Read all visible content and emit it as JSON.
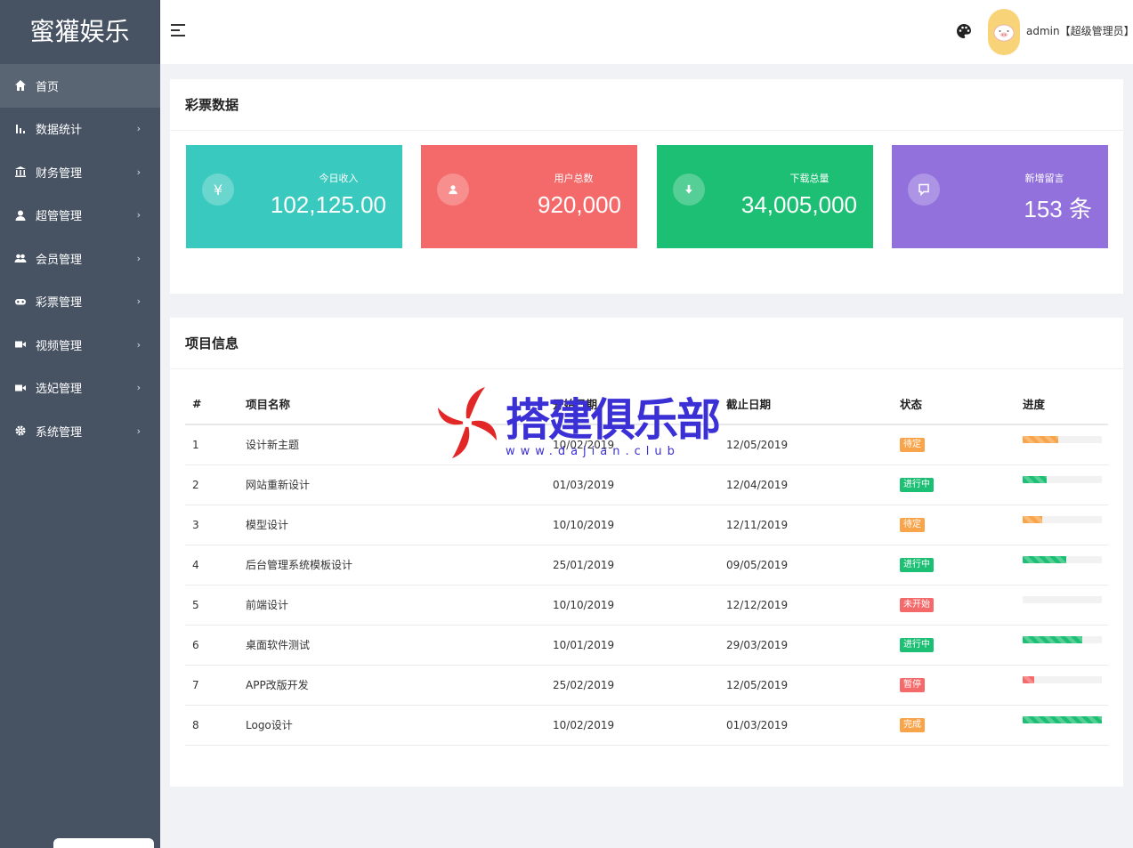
{
  "app": {
    "title": "蜜獾娱乐"
  },
  "sidebar": {
    "items": [
      {
        "label": "首页",
        "icon": "home-icon",
        "arrow": ""
      },
      {
        "label": "数据统计",
        "icon": "bar-chart-icon",
        "arrow": "›"
      },
      {
        "label": "财务管理",
        "icon": "bank-icon",
        "arrow": "›"
      },
      {
        "label": "超管管理",
        "icon": "user-icon",
        "arrow": "›"
      },
      {
        "label": "会员管理",
        "icon": "users-icon",
        "arrow": "›"
      },
      {
        "label": "彩票管理",
        "icon": "gamepad-icon",
        "arrow": "›"
      },
      {
        "label": "视频管理",
        "icon": "video-icon",
        "arrow": "›"
      },
      {
        "label": "选妃管理",
        "icon": "video-icon",
        "arrow": "›"
      },
      {
        "label": "系统管理",
        "icon": "gear-icon",
        "arrow": "›"
      }
    ]
  },
  "header": {
    "user": "admin【超级管理员】",
    "caret": "▾"
  },
  "lottery": {
    "title": "彩票数据",
    "stats": [
      {
        "label": "今日收入",
        "value": "102,125.00",
        "icon": "yen-icon",
        "glyph": "¥",
        "color": "#3ac9be"
      },
      {
        "label": "用户总数",
        "value": "920,000",
        "icon": "user-icon",
        "glyph": "",
        "color": "#f46a6a"
      },
      {
        "label": "下载总量",
        "value": "34,005,000",
        "icon": "download-icon",
        "glyph": "",
        "color": "#1cbf73"
      },
      {
        "label": "新增留言",
        "value": "153 条",
        "icon": "message-icon",
        "glyph": "",
        "color": "#9271dd"
      }
    ]
  },
  "projects": {
    "title": "项目信息",
    "columns": [
      "#",
      "项目名称",
      "开始日期",
      "截止日期",
      "状态",
      "进度"
    ],
    "rows": [
      {
        "id": "1",
        "name": "设计新主题",
        "start": "10/02/2019",
        "end": "12/05/2019",
        "status": "待定",
        "status_color": "#f8a44a",
        "progress": 0.45,
        "bar_color": "#f8a44a"
      },
      {
        "id": "2",
        "name": "网站重新设计",
        "start": "01/03/2019",
        "end": "12/04/2019",
        "status": "进行中",
        "status_color": "#1cbf73",
        "progress": 0.3,
        "bar_color": "#1cbf73"
      },
      {
        "id": "3",
        "name": "模型设计",
        "start": "10/10/2019",
        "end": "12/11/2019",
        "status": "待定",
        "status_color": "#f8a44a",
        "progress": 0.25,
        "bar_color": "#f8a44a"
      },
      {
        "id": "4",
        "name": "后台管理系统模板设计",
        "start": "25/01/2019",
        "end": "09/05/2019",
        "status": "进行中",
        "status_color": "#1cbf73",
        "progress": 0.55,
        "bar_color": "#1cbf73"
      },
      {
        "id": "5",
        "name": "前端设计",
        "start": "10/10/2019",
        "end": "12/12/2019",
        "status": "未开始",
        "status_color": "#f46a6a",
        "progress": 0,
        "bar_color": "#f46a6a"
      },
      {
        "id": "6",
        "name": "桌面软件测试",
        "start": "10/01/2019",
        "end": "29/03/2019",
        "status": "进行中",
        "status_color": "#1cbf73",
        "progress": 0.75,
        "bar_color": "#1cbf73"
      },
      {
        "id": "7",
        "name": "APP改版开发",
        "start": "25/02/2019",
        "end": "12/05/2019",
        "status": "暂停",
        "status_color": "#f46a6a",
        "progress": 0.15,
        "bar_color": "#f46a6a"
      },
      {
        "id": "8",
        "name": "Logo设计",
        "start": "10/02/2019",
        "end": "01/03/2019",
        "status": "完成",
        "status_color": "#f8a44a",
        "progress": 1.0,
        "bar_color": "#1cbf73"
      }
    ]
  },
  "watermark": {
    "text": "搭建俱乐部",
    "url": "www.dajian.club"
  }
}
